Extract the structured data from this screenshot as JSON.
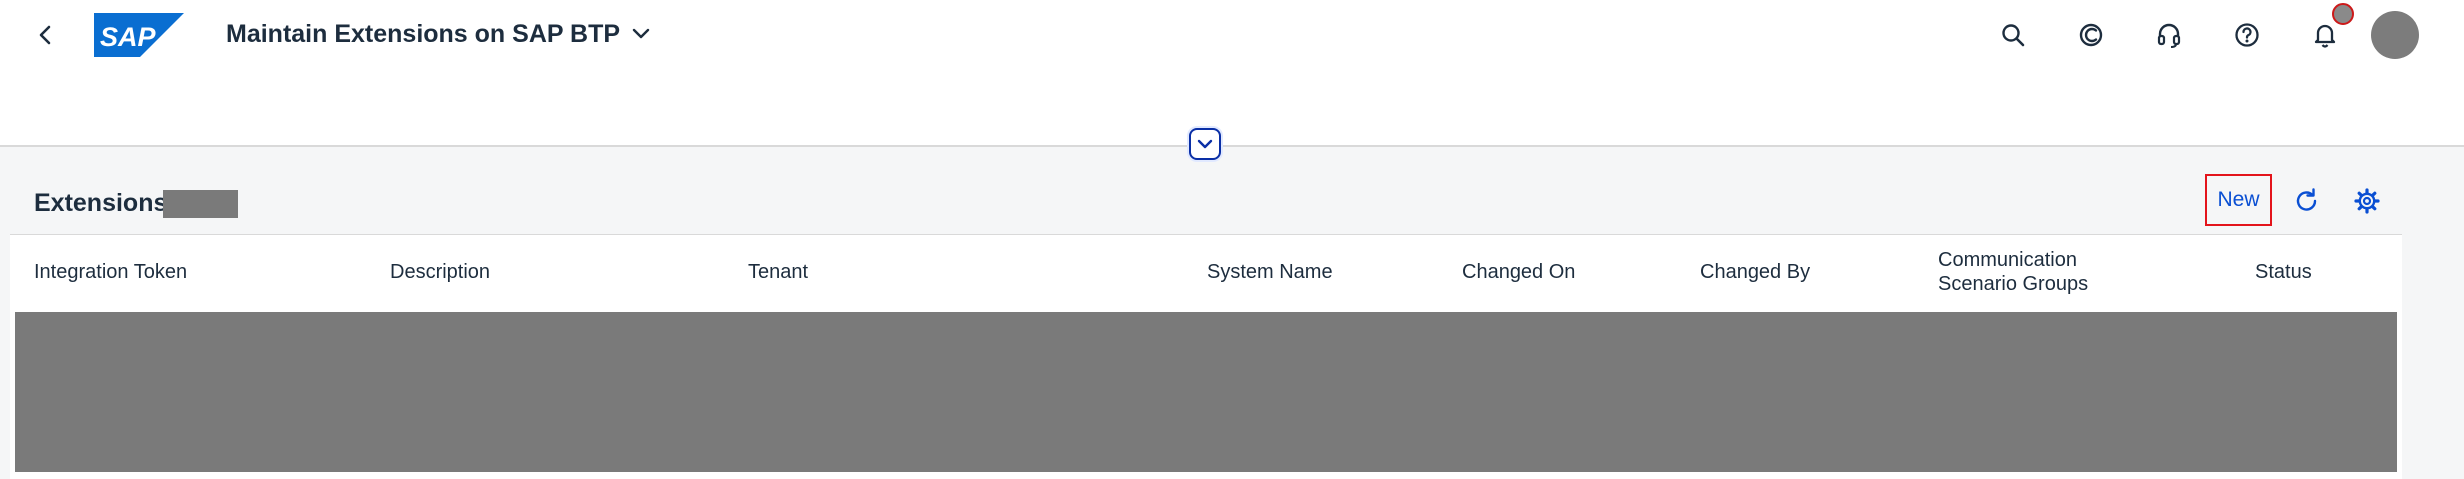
{
  "shell": {
    "app_title": "Maintain Extensions on SAP BTP",
    "logo_text": "SAP",
    "colors": {
      "logo_blue": "#0a6ed1",
      "link_blue": "#0a4fd3",
      "highlight_red": "#e3141b"
    },
    "icons": [
      "back-icon",
      "chevron-down-icon",
      "search-icon",
      "joule-icon",
      "headset-icon",
      "help-icon",
      "bell-icon"
    ]
  },
  "table": {
    "title": "Extensions",
    "new_label": "New",
    "columns": [
      "Integration Token",
      "Description",
      "Tenant",
      "System Name",
      "Changed On",
      "Changed By",
      "Communication Scenario Groups",
      "Status"
    ]
  }
}
